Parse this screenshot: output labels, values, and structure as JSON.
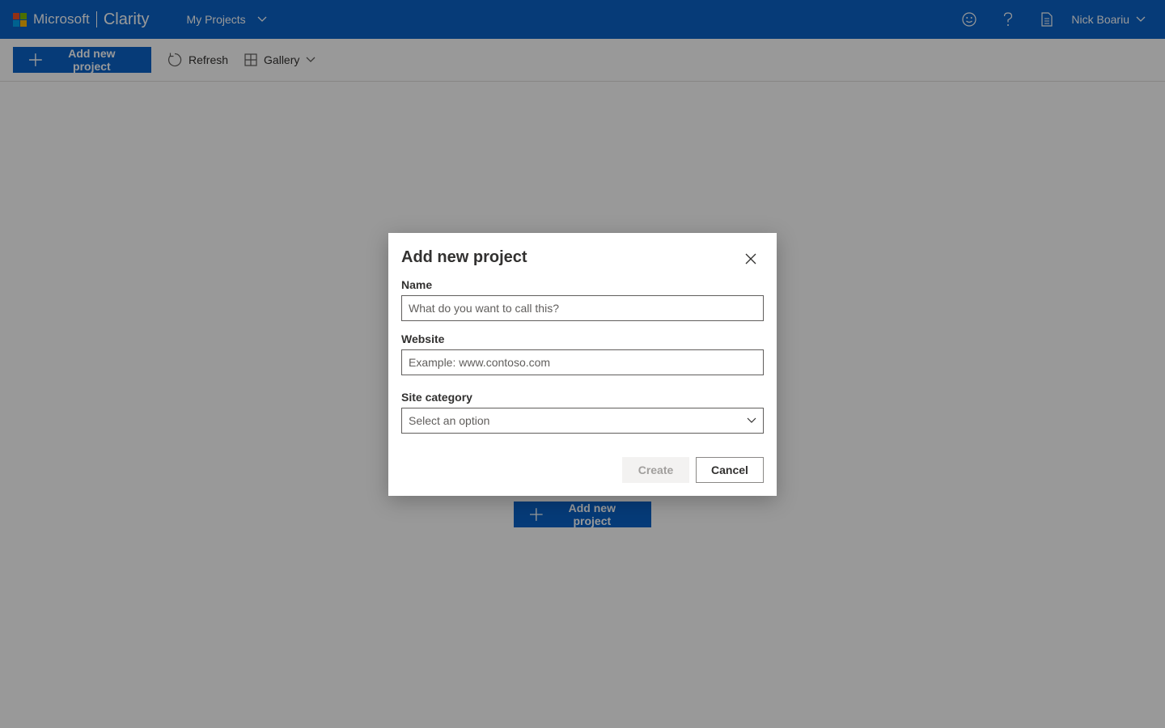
{
  "brand": {
    "company": "Microsoft",
    "app": "Clarity",
    "logo_colors": [
      "#f25022",
      "#7fba00",
      "#00a4ef",
      "#ffb900"
    ]
  },
  "header": {
    "project_picker": "My Projects",
    "icons": [
      "smiley-icon",
      "help-icon",
      "document-icon"
    ],
    "user_name": "Nick Boariu",
    "bg_color": "#0a63c9"
  },
  "toolbar": {
    "add_label": "Add new project",
    "refresh_label": "Refresh",
    "view_label": "Gallery"
  },
  "empty_state": {
    "add_label": "Add new project"
  },
  "dialog": {
    "title": "Add new project",
    "name": {
      "label": "Name",
      "placeholder": "What do you want to call this?"
    },
    "website": {
      "label": "Website",
      "placeholder": "Example: www.contoso.com"
    },
    "category": {
      "label": "Site category",
      "selected": "Select an option"
    },
    "create_label": "Create",
    "cancel_label": "Cancel"
  }
}
